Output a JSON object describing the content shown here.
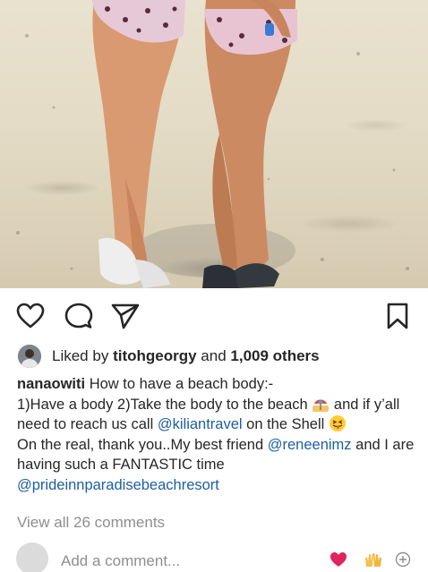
{
  "post": {
    "liked_by_prefix": "Liked by",
    "liked_by_user": "titohgeorgy",
    "liked_by_and": "and",
    "liked_by_others": "1,009 others",
    "caption_user": "nanaowiti",
    "caption_part1": "How to have a beach body:-",
    "caption_part2": "1)Have a body 2)Take the body to the beach",
    "caption_part3": "and if y’all need to reach us call",
    "mention_1": "@kiliantravel",
    "caption_part4": "on the Shell",
    "caption_part5": "On the real, thank you..My best friend",
    "mention_2": "@reneenimz",
    "caption_part6": "and I are having such a FANTASTIC time",
    "mention_3": "@prideinnparadisebeachresort",
    "view_all_comments": "View all 26 comments"
  },
  "comment_box": {
    "placeholder": "Add a comment..."
  },
  "icons": {
    "like": "heart-outline-icon",
    "comment": "comment-bubble-icon",
    "share": "paper-plane-icon",
    "save": "bookmark-icon",
    "quick_heart": "red-heart-emoji",
    "quick_hands": "raised-hands-emoji",
    "add_emoji": "plus-circle-icon"
  },
  "colors": {
    "text": "#262626",
    "mention": "#1d5fa3",
    "muted": "#8e8e8e",
    "heart": "#e0245e"
  }
}
